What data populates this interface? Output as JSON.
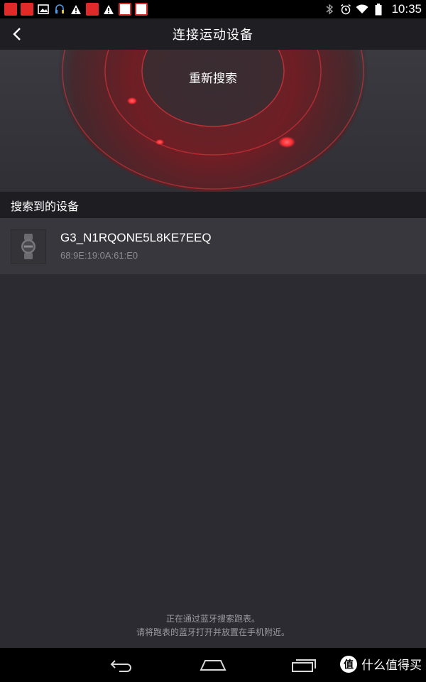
{
  "status_bar": {
    "time": "10:35",
    "left_icons": [
      "suning-icon",
      "suning-icon",
      "image-icon",
      "headset-icon",
      "warning-icon",
      "tmall-icon",
      "warning-icon",
      "news-icon",
      "news-icon"
    ],
    "right_icons": [
      "bluetooth-icon",
      "alarm-icon",
      "wifi-icon",
      "battery-icon"
    ]
  },
  "header": {
    "title": "连接运动设备",
    "back_icon": "chevron-left-icon"
  },
  "radar": {
    "rescan_label": "重新搜索",
    "accent_color": "#e8343a"
  },
  "section": {
    "title": "搜索到的设备"
  },
  "devices": [
    {
      "name": "G3_N1RQONE5L8KE7EEQ",
      "mac": "68:9E:19:0A:61:E0",
      "icon": "watch-icon"
    }
  ],
  "hint": {
    "line1": "正在通过蓝牙搜索跑表。",
    "line2": "请将跑表的蓝牙打开并放置在手机附近。"
  },
  "nav_bar": {
    "buttons": [
      "back-icon",
      "home-icon",
      "recents-icon"
    ],
    "watermark_badge": "值",
    "watermark_text": "什么值得买"
  }
}
